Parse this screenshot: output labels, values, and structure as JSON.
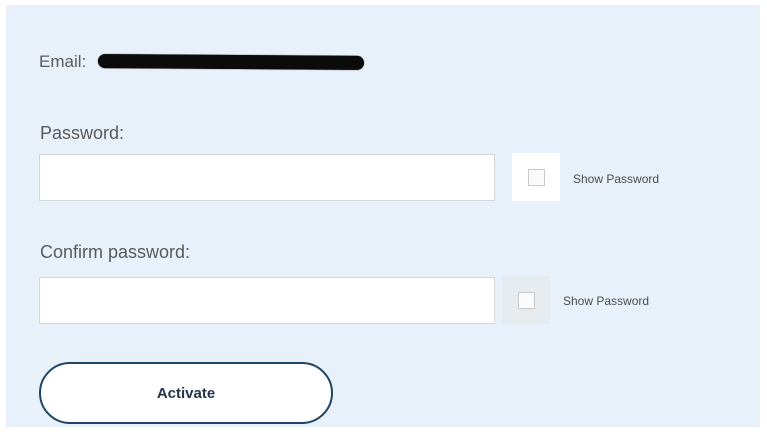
{
  "form": {
    "email_label": "Email:",
    "email_value_redacted": true,
    "password_label": "Password:",
    "password_value": "",
    "password_placeholder": "",
    "show_password_label_1": "Show Password",
    "show_password_checked_1": false,
    "confirm_label": "Confirm password:",
    "confirm_value": "",
    "confirm_placeholder": "",
    "show_password_label_2": "Show Password",
    "show_password_checked_2": false,
    "activate_label": "Activate"
  },
  "colors": {
    "panel_background": "#e8f0f9",
    "button_border": "#1e4566",
    "button_text": "#23344a",
    "label_text": "#5a5a5a"
  }
}
